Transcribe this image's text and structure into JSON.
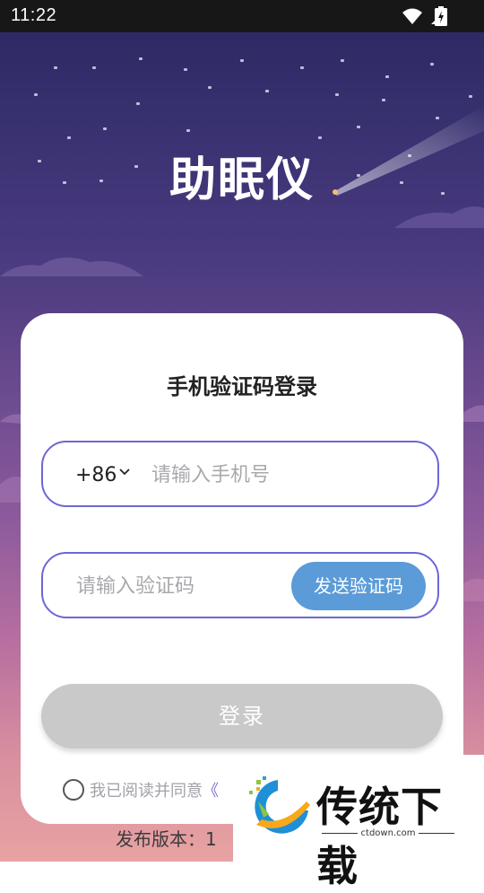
{
  "status_bar": {
    "time": "11:22"
  },
  "app": {
    "title": "助眠仪"
  },
  "login_card": {
    "title": "手机验证码登录",
    "phone_field": {
      "country_code": "+86",
      "placeholder": "请输入手机号",
      "value": ""
    },
    "code_field": {
      "placeholder": "请输入验证码",
      "value": "",
      "send_button_label": "发送验证码"
    },
    "login_button_label": "登录",
    "agreement": {
      "text": "我已阅读并同意",
      "link_text": "《"
    }
  },
  "footer": {
    "version_text": "发布版本：1"
  },
  "watermark": {
    "brand": "传统下载",
    "url": "ctdown.com"
  },
  "colors": {
    "accent_border": "#6e66d6",
    "send_button": "#5b9bd8",
    "login_button_disabled": "#c9c9c9"
  },
  "icons": [
    "wifi-icon",
    "signal-icon",
    "battery-icon",
    "chevron-down-icon",
    "radio-icon",
    "watermark-logo-icon"
  ]
}
